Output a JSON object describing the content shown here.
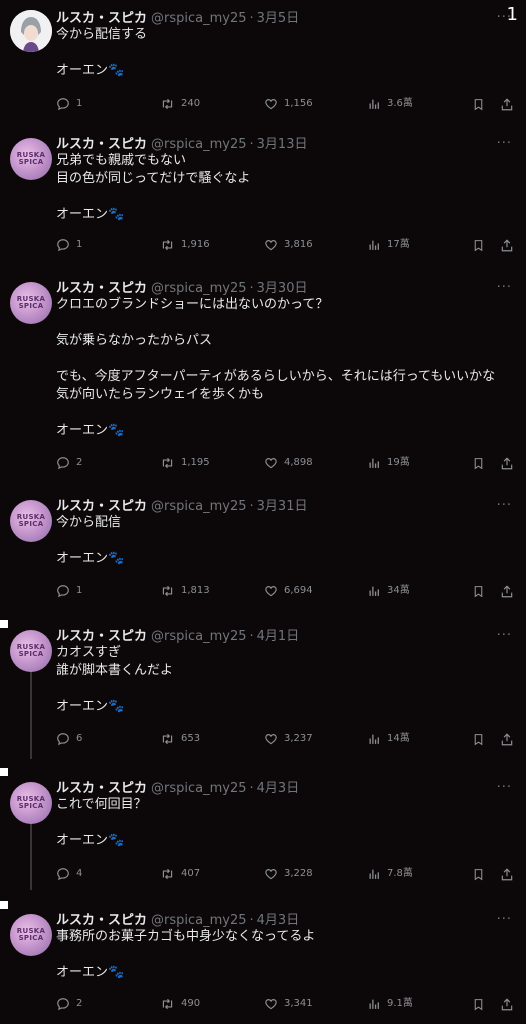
{
  "page_counter": "1",
  "tweets": [
    {
      "name": "ルスカ・スピカ",
      "handle": "@rspica_my25",
      "date": "3月5日",
      "text": "今から配信する\n\nオーエン🐾",
      "replies": "1",
      "retweets": "240",
      "likes": "1,156",
      "views": "3.6萬"
    },
    {
      "name": "ルスカ・スピカ",
      "handle": "@rspica_my25",
      "date": "3月13日",
      "text": "兄弟でも親戚でもない\n目の色が同じってだけで騒ぐなよ\n\nオーエン🐾",
      "replies": "1",
      "retweets": "1,916",
      "likes": "3,816",
      "views": "17萬"
    },
    {
      "name": "ルスカ・スピカ",
      "handle": "@rspica_my25",
      "date": "3月30日",
      "text": "クロエのブランドショーには出ないのかって？\n\n気が乗らなかったからパス\n\nでも、今度アフターパーティがあるらしいから、それには行ってもいいかな\n気が向いたらランウェイを歩くかも\n\nオーエン🐾",
      "replies": "2",
      "retweets": "1,195",
      "likes": "4,898",
      "views": "19萬"
    },
    {
      "name": "ルスカ・スピカ",
      "handle": "@rspica_my25",
      "date": "3月31日",
      "text": "今から配信\n\nオーエン🐾",
      "replies": "1",
      "retweets": "1,813",
      "likes": "6,694",
      "views": "34萬"
    },
    {
      "name": "ルスカ・スピカ",
      "handle": "@rspica_my25",
      "date": "4月1日",
      "text": "カオスすぎ\n誰が脚本書くんだよ\n\nオーエン🐾",
      "replies": "6",
      "retweets": "653",
      "likes": "3,237",
      "views": "14萬"
    },
    {
      "name": "ルスカ・スピカ",
      "handle": "@rspica_my25",
      "date": "4月3日",
      "text": "これで何回目？\n\nオーエン🐾",
      "replies": "4",
      "retweets": "407",
      "likes": "3,228",
      "views": "7.8萬"
    },
    {
      "name": "ルスカ・スピカ",
      "handle": "@rspica_my25",
      "date": "4月3日",
      "text": "事務所のお菓子カゴも中身少なくなってるよ\n\nオーエン🐾",
      "replies": "2",
      "retweets": "490",
      "likes": "3,341",
      "views": "9.1萬"
    }
  ],
  "avatar_label": "RUSKA\nSPICA",
  "more_label": "···",
  "colors": {
    "background": "#0c0708",
    "text": "#e7e9ea",
    "muted": "#71767b"
  }
}
